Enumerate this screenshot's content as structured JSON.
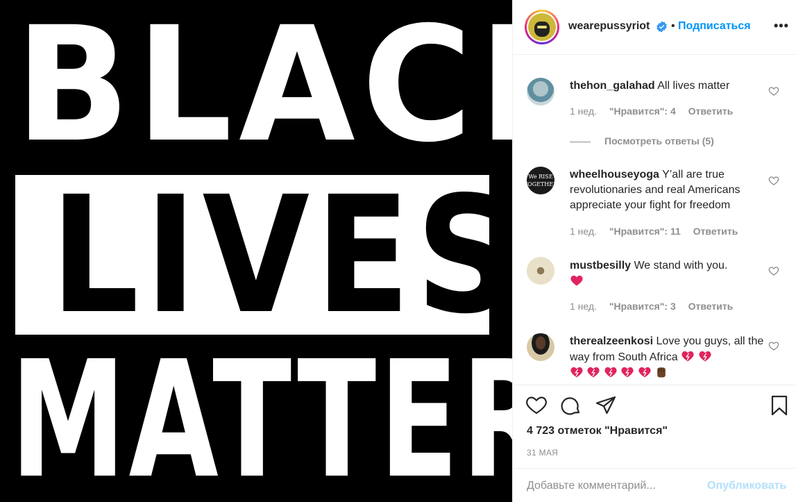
{
  "media": {
    "line1": "BLACK",
    "line2": "LIVES",
    "line3": "MATTER"
  },
  "header": {
    "username": "wearepussyriot",
    "separator": "•",
    "follow_label": "Подписаться",
    "more_label": "•••"
  },
  "comments": [
    {
      "username": "thehon_galahad",
      "text": "All lives matter",
      "time": "1 нед.",
      "likes": "\"Нравится\": 4",
      "reply": "Ответить"
    },
    {
      "username": "wheelhouseyoga",
      "text": "Y’all are true revolutionaries and real Americans appreciate your fight for freedom",
      "time": "1 нед.",
      "likes": "\"Нравится\": 11",
      "reply": "Ответить"
    },
    {
      "username": "mustbesilly",
      "text": "We stand with you.",
      "time": "1 нед.",
      "likes": "\"Нравится\": 3",
      "reply": "Ответить"
    },
    {
      "username": "therealzeenkosi",
      "text": "Love you guys, all the way from South Africa"
    }
  ],
  "view_replies": "Посмотреть ответы (5)",
  "actions": {
    "likes_count": "4 723 отметок \"Нравится\"",
    "date": "31 МАЯ"
  },
  "add_comment": {
    "placeholder": "Добавьте комментарий...",
    "publish_label": "Опубликовать"
  },
  "colors": {
    "accent": "#0095f6",
    "muted": "#8e8e8e",
    "publish_disabled": "#b2dffc",
    "heart_emoji": "#e0245e"
  }
}
